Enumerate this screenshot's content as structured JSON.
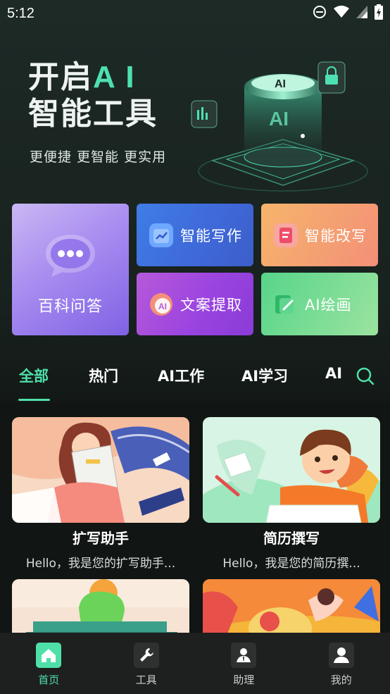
{
  "status_bar": {
    "time": "5:12"
  },
  "hero": {
    "title_line1_prefix": "开启",
    "title_line1_ai": "A I",
    "title_line2": "智能工具",
    "subtitle": "更便捷  更智能  更实用"
  },
  "features": {
    "big": {
      "label": "百科问答",
      "icon": "chat-bubble-icon"
    },
    "write": {
      "label": "智能写作",
      "icon": "pen-chart-icon"
    },
    "rewrite": {
      "label": "智能改写",
      "icon": "document-edit-icon"
    },
    "extract": {
      "label": "文案提取",
      "icon": "ai-extract-icon"
    },
    "draw": {
      "label": "AI绘画",
      "icon": "paint-brush-icon"
    }
  },
  "tabs": [
    {
      "label": "全部",
      "active": true
    },
    {
      "label": "热门",
      "active": false
    },
    {
      "label": "AI工作",
      "active": false
    },
    {
      "label": "AI学习",
      "active": false
    },
    {
      "label": "AI",
      "active": false
    }
  ],
  "cards": [
    {
      "title": "扩写助手",
      "desc": "Hello，我是您的扩写助手..."
    },
    {
      "title": "简历撰写",
      "desc": "Hello，我是您的简历撰..."
    }
  ],
  "bottom_nav": [
    {
      "label": "首页",
      "icon": "home-icon",
      "active": true
    },
    {
      "label": "工具",
      "icon": "wrench-icon",
      "active": false
    },
    {
      "label": "助理",
      "icon": "assistant-icon",
      "active": false
    },
    {
      "label": "我的",
      "icon": "profile-icon",
      "active": false
    }
  ],
  "colors": {
    "accent": "#4ee0a8",
    "background": "#141a18",
    "nav_bg": "#1e1f1f"
  }
}
